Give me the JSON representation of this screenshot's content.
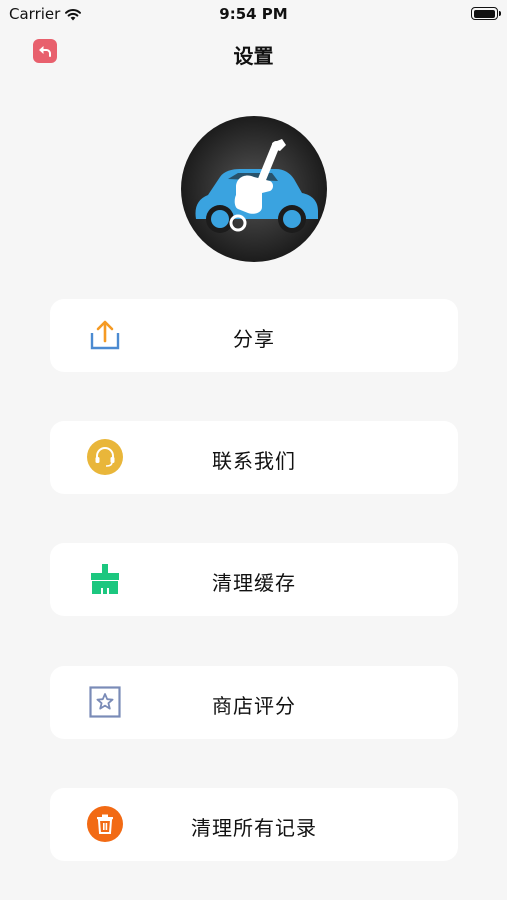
{
  "status_bar": {
    "carrier": "Carrier",
    "time": "9:54 PM",
    "battery_level": 1.0
  },
  "nav": {
    "title": "设置",
    "back_icon": "back-arrow-icon"
  },
  "logo": {
    "icon": "car-wrench-logo"
  },
  "menu": [
    {
      "label": "分享",
      "icon": "share-icon",
      "color": "#f59a23"
    },
    {
      "label": "联系我们",
      "icon": "headset-icon",
      "color": "#e9b63a"
    },
    {
      "label": "清理缓存",
      "icon": "broom-icon",
      "color": "#1cc77f"
    },
    {
      "label": "商店评分",
      "icon": "star-icon",
      "color": "#7a8bb7"
    },
    {
      "label": "清理所有记录",
      "icon": "trash-icon",
      "color": "#f26a14"
    }
  ]
}
